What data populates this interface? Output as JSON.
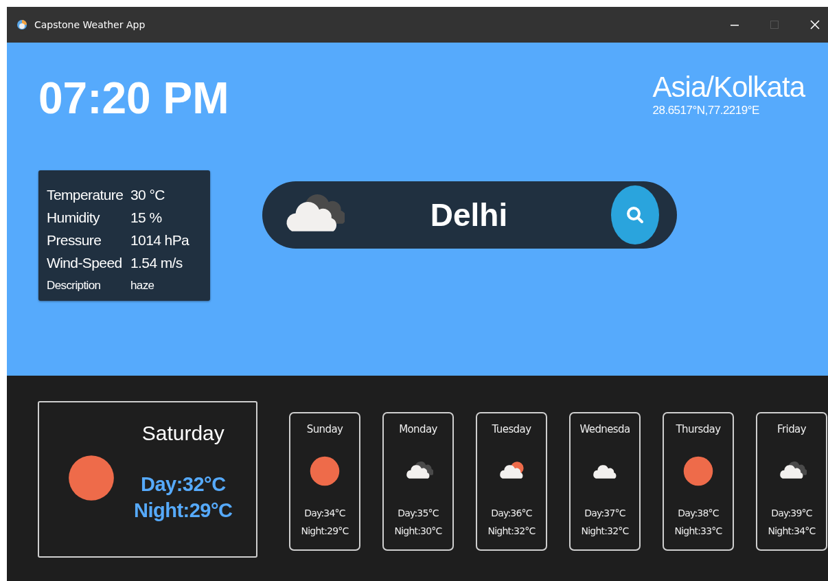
{
  "window": {
    "title": "Capstone Weather App"
  },
  "clock": {
    "time": "07:20 PM"
  },
  "location": {
    "timezone": "Asia/Kolkata",
    "coordinates": "28.6517°N,77.2219°E"
  },
  "details": [
    {
      "label": "Temperature",
      "value": "30 °C",
      "kind": "large"
    },
    {
      "label": "Humidity",
      "value": "15 %",
      "kind": "large"
    },
    {
      "label": "Pressure",
      "value": "1014 hPa",
      "kind": "large"
    },
    {
      "label": "Wind-Speed",
      "value": "1.54 m/s",
      "kind": "large"
    },
    {
      "label": "Description",
      "value": "haze",
      "kind": "small"
    }
  ],
  "search": {
    "value": "Delhi",
    "kind": "clouds"
  },
  "today": {
    "day": "Saturday",
    "kind": "sun",
    "day_temp": "Day:32°C",
    "night_temp": "Night:29°C"
  },
  "forecast": [
    {
      "day": "Sunday",
      "kind": "sun",
      "day_temp": "Day:34°C",
      "night_temp": "Night:29°C"
    },
    {
      "day": "Monday",
      "kind": "clouds",
      "day_temp": "Day:35°C",
      "night_temp": "Night:30°C"
    },
    {
      "day": "Tuesday",
      "kind": "partly",
      "day_temp": "Day:36°C",
      "night_temp": "Night:32°C"
    },
    {
      "day": "Wednesda",
      "kind": "cloud",
      "day_temp": "Day:37°C",
      "night_temp": "Night:32°C"
    },
    {
      "day": "Thursday",
      "kind": "sun",
      "day_temp": "Day:38°C",
      "night_temp": "Night:33°C"
    },
    {
      "day": "Friday",
      "kind": "clouds",
      "day_temp": "Day:39°C",
      "night_temp": "Night:34°C"
    }
  ]
}
